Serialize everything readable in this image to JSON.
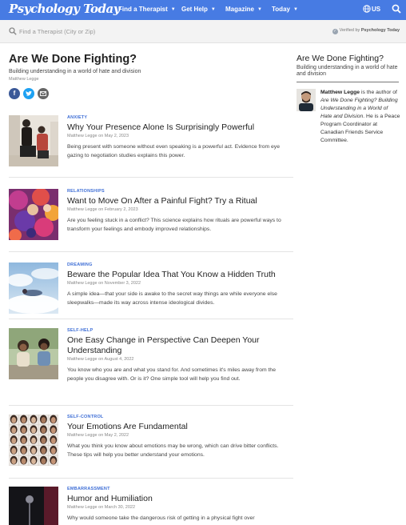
{
  "nav": {
    "logo": "Psychology Today",
    "items": [
      {
        "label": "Find a Therapist"
      },
      {
        "label": "Get Help"
      },
      {
        "label": "Magazine"
      },
      {
        "label": "Today"
      }
    ],
    "region": "US"
  },
  "search": {
    "placeholder": "Find a Therapist (City or Zip)",
    "verified_prefix": "Verified by",
    "verified_brand": "Psychology Today"
  },
  "blog": {
    "title": "Are We Done Fighting?",
    "subtitle": "Building understanding in a world of hate and division",
    "author": "Matthew Legge"
  },
  "posts": [
    {
      "tag": "ANXIETY",
      "title": "Why Your Presence Alone Is Surprisingly Powerful",
      "meta": "Matthew Legge on May 2, 2023",
      "teaser": "Being present with someone without even speaking is a powerful act. Evidence from eye gazing to negotiation studies explains this power."
    },
    {
      "tag": "RELATIONSHIPS",
      "title": "Want to Move On After a Painful Fight? Try a Ritual",
      "meta": "Matthew Legge on February 2, 2023",
      "teaser": "Are you feeling stuck in a conflict? This science explains how rituals are powerful ways to transform your feelings and embody improved relationships."
    },
    {
      "tag": "DREAMING",
      "title": "Beware the Popular Idea That You Know a Hidden Truth",
      "meta": "Matthew Legge on November 3, 2022",
      "teaser": "A simple idea—that your side is awake to the secret way things are while everyone else sleepwalks—made its way across intense ideological divides."
    },
    {
      "tag": "SELF-HELP",
      "title": "One Easy Change in Perspective Can Deepen Your Understanding",
      "meta": "Matthew Legge on August 4, 2022",
      "teaser": "You know who you are and what you stand for. And sometimes it's miles away from the people you disagree with. Or is it? One simple tool will help you find out."
    },
    {
      "tag": "SELF-CONTROL",
      "title": "Your Emotions Are Fundamental",
      "meta": "Matthew Legge on May 2, 2022",
      "teaser": "What you think you know about emotions may be wrong, which can drive bitter conflicts. These tips will help you better understand your emotions."
    },
    {
      "tag": "EMBARRASSMENT",
      "title": "Humor and Humiliation",
      "meta": "Matthew Legge on March 30, 2022",
      "teaser": "Why would someone take the dangerous risk of getting in a physical fight over"
    }
  ],
  "sidebar": {
    "title": "Are We Done Fighting?",
    "subtitle": "Building understanding in a world of hate and division",
    "bio_name": "Matthew Legge",
    "bio_pre": " is the author of ",
    "bio_book": "Are We Done Fighting? Building Understanding in a World of Hate and Division",
    "bio_post": ". He is a Peace Program Coordinator at Canadian Friends Service Committee."
  },
  "colors": {
    "brand": "#477be3",
    "tag": "#3f6fd6"
  }
}
